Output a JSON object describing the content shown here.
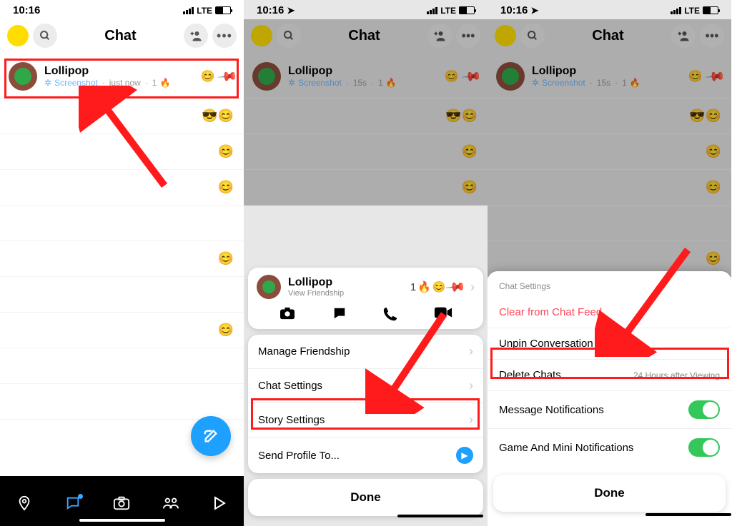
{
  "status": {
    "time": "10:16",
    "carrier_label": "LTE"
  },
  "header": {
    "title": "Chat",
    "search_icon": "search",
    "add_friend_icon": "add-friend",
    "more_icon": "more"
  },
  "friend": {
    "name": "Lollipop",
    "status_icon": "screenshot",
    "status_text": "Screenshot",
    "streak_count": "1",
    "streak_emoji": "🔥",
    "right_emoji": "😊",
    "pinned": true
  },
  "friend_time": {
    "p1": "just now",
    "p2": "15s",
    "p3": "15s"
  },
  "placeholder_rows": [
    {
      "emojis": "😎😊"
    },
    {
      "emojis": "😊"
    },
    {
      "emojis": "😊"
    },
    {
      "emojis": ""
    },
    {
      "emojis": "😊"
    },
    {
      "emojis": ""
    },
    {
      "emojis": "😊"
    },
    {
      "emojis": ""
    },
    {
      "emojis": ""
    }
  ],
  "tabs": {
    "map": "map",
    "chat": "chat",
    "camera": "camera",
    "stories": "stories",
    "play": "play"
  },
  "profile_card": {
    "name": "Lollipop",
    "subtitle": "View Friendship",
    "streak": "1",
    "actions": {
      "camera": "camera",
      "chat": "chat",
      "call": "call",
      "video": "video"
    }
  },
  "menu2": {
    "manage": "Manage Friendship",
    "chat_settings": "Chat Settings",
    "story_settings": "Story Settings",
    "send_profile": "Send Profile To..."
  },
  "sheet3": {
    "header": "Chat Settings",
    "clear": "Clear from Chat Feed",
    "unpin": "Unpin Conversation",
    "delete": "Delete Chats...",
    "delete_hint": "24 Hours after Viewing",
    "msg_notif": "Message Notifications",
    "game_notif": "Game And Mini Notifications"
  },
  "done_label": "Done"
}
